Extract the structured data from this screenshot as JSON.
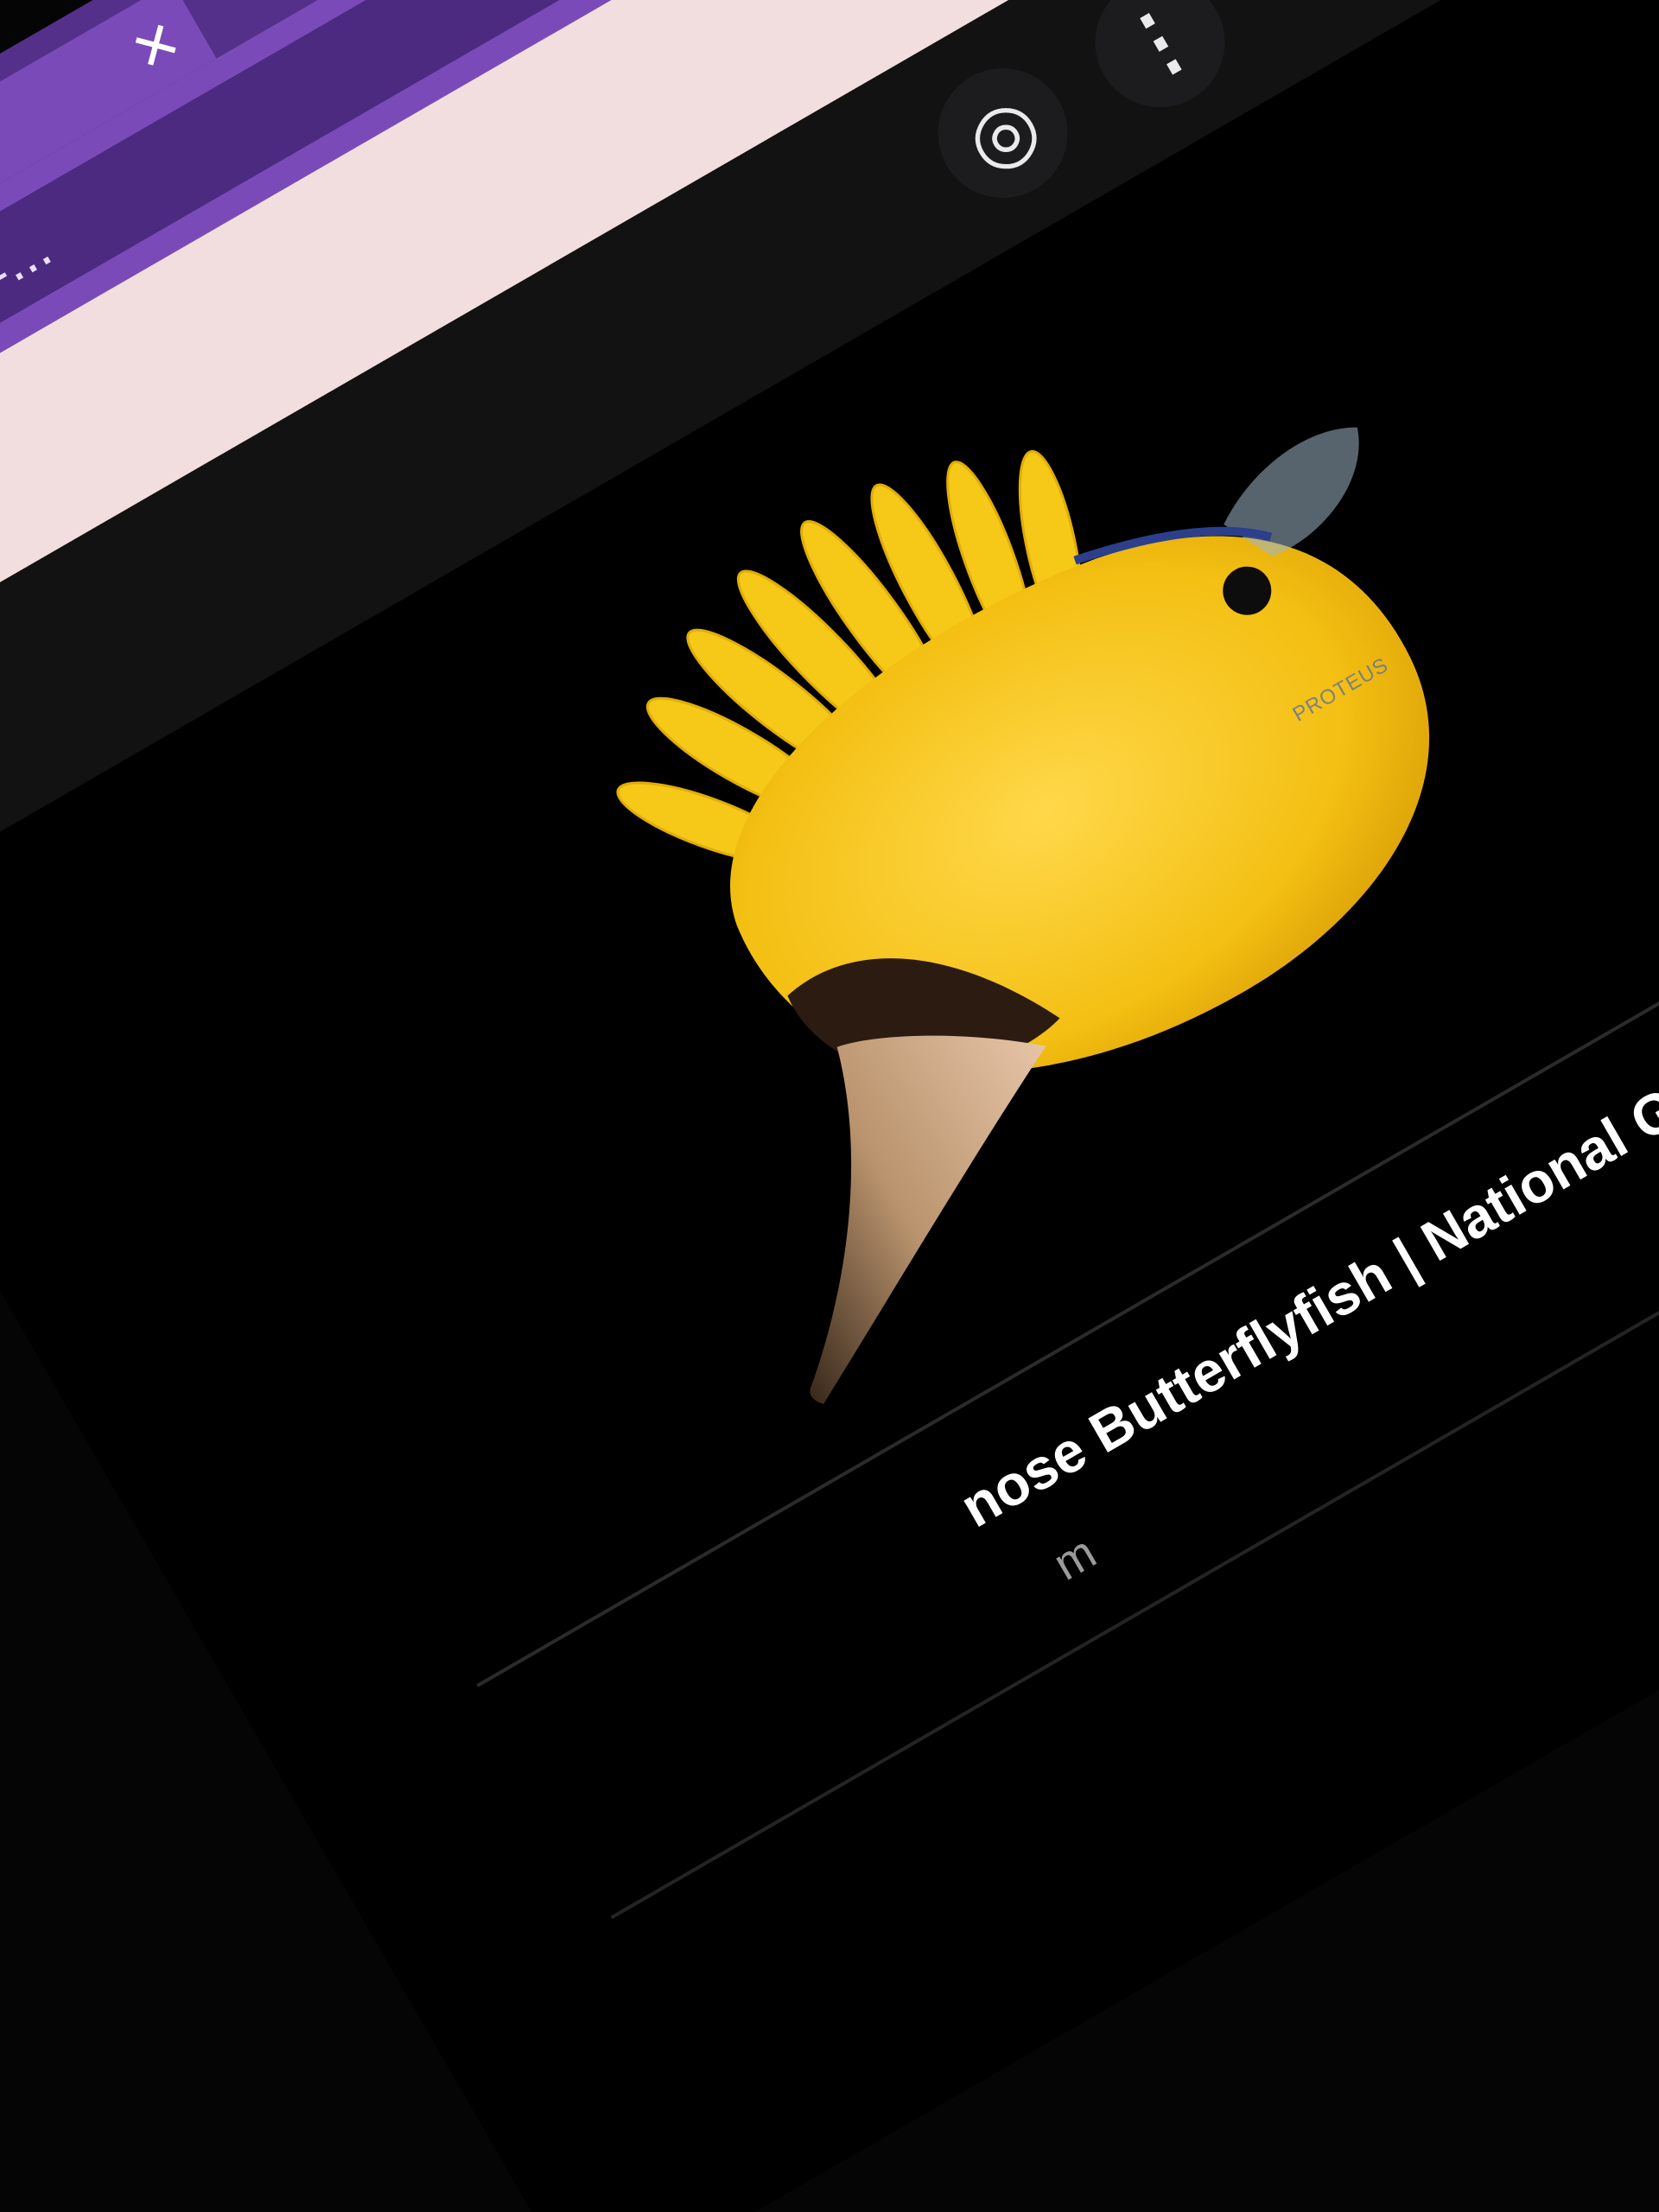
{
  "tabstrip": {
    "tab_close_glyph": "✕",
    "new_tab_glyph": "+",
    "extension_icon": "atom-icon"
  },
  "toolbar": {
    "url": "tterflyfish&gs_lcp=...",
    "share_icon": "share-icon",
    "bookmark_icon": "star-icon"
  },
  "pagebar": {
    "settings_icon": "gear-icon"
  },
  "viewer": {
    "lens_icon": "google-lens-icon",
    "more_icon": "more-vert-icon",
    "prev_icon": "chevron-left-icon",
    "next_icon": "chevron-right-icon",
    "watermark": "PROTEUS",
    "caption": "nose Butterflyfish | National G",
    "caption_sub": "m"
  },
  "colors": {
    "tabstrip": "#55308a",
    "toolbar": "#7a4bb8",
    "omnibox": "#4b2a80",
    "pagebar": "#f2dede",
    "viewer": "#000000",
    "fish_yellow": "#f5c518"
  }
}
